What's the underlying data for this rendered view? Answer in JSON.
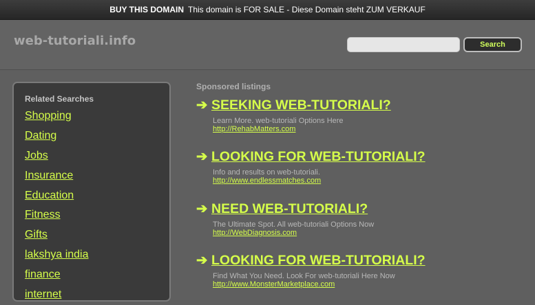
{
  "topbar": {
    "buy_label": "BUY THIS DOMAIN",
    "message": "This domain is FOR SALE - Diese Domain steht ZUM VERKAUF"
  },
  "header": {
    "site_title": "web-tutoriali.info",
    "search_placeholder": "",
    "search_button": "Search"
  },
  "sidebar": {
    "heading": "Related Searches",
    "items": [
      "Shopping",
      "Dating",
      "Jobs",
      "Insurance",
      "Education",
      "Fitness",
      "Gifts",
      "lakshya india",
      "finance",
      "internet"
    ]
  },
  "main": {
    "sponsored_label": "Sponsored listings",
    "listings": [
      {
        "title": "SEEKING WEB-TUTORIALI?",
        "desc": "Learn More. web-tutoriali Options Here",
        "url": "http://RehabMatters.com"
      },
      {
        "title": "LOOKING FOR WEB-TUTORIALI?",
        "desc": "Info and results on web-tutoriali.",
        "url": "http://www.endlessmatches.com"
      },
      {
        "title": "NEED WEB-TUTORIALI?",
        "desc": "The Ultimate Spot. All web-tutoriali Options Now",
        "url": "http://WebDiagnosis.com"
      },
      {
        "title": "LOOKING FOR WEB-TUTORIALI?",
        "desc": "Find What You Need. Look For web-tutoriali Here Now",
        "url": "http://www.MonsterMarketplace.com"
      }
    ]
  },
  "colors": {
    "accent": "#d6ff4a",
    "background": "#5f5f5f",
    "panel": "#3a3a3a"
  }
}
